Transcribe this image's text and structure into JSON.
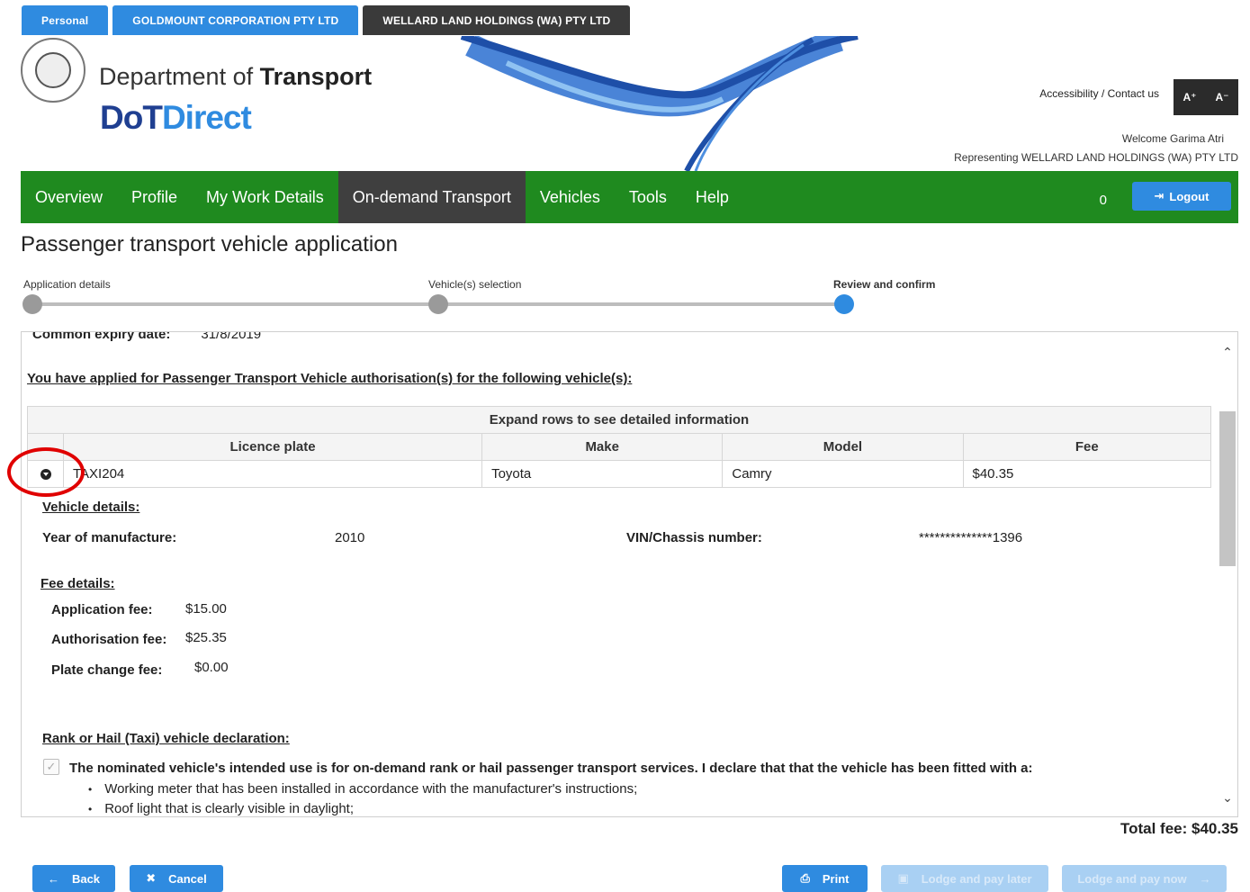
{
  "account_tabs": [
    "Personal",
    "GOLDMOUNT CORPORATION PTY LTD",
    "WELLARD LAND HOLDINGS (WA) PTY LTD"
  ],
  "header": {
    "dept_prefix": "Department of ",
    "dept_bold": "Transport",
    "brand_a": "DoT",
    "brand_b": "Direct",
    "accessibility": "Accessibility / Contact us",
    "font_up": "A⁺",
    "font_down": "A⁻",
    "welcome": "Welcome Garima Atri",
    "representing": "Representing WELLARD LAND HOLDINGS (WA) PTY LTD"
  },
  "nav": {
    "items": [
      "Overview",
      "Profile",
      "My Work Details",
      "On-demand Transport",
      "Vehicles",
      "Tools",
      "Help"
    ],
    "count": "0",
    "logout": "Logout"
  },
  "page_title": "Passenger transport vehicle application",
  "stepper": [
    "Application details",
    "Vehicle(s) selection",
    "Review and confirm"
  ],
  "panel": {
    "expiry_label": "Common expiry date:",
    "expiry_value": "31/8/2019",
    "applied_heading": "You have applied for Passenger Transport Vehicle authorisation(s) for the following vehicle(s):",
    "table_caption": "Expand rows to see detailed information",
    "columns": [
      "Licence plate",
      "Make",
      "Model",
      "Fee"
    ],
    "row": {
      "plate": "TAXI204",
      "make": "Toyota",
      "model": "Camry",
      "fee": "$40.35"
    },
    "vehicle_details_heading": "Vehicle details:",
    "year_label": "Year of manufacture:",
    "year_value": "2010",
    "vin_label": "VIN/Chassis number:",
    "vin_value": "**************1396",
    "fee_details_heading": "Fee details:",
    "app_fee_label": "Application fee:",
    "app_fee_value": "$15.00",
    "auth_fee_label": "Authorisation fee:",
    "auth_fee_value": "$25.35",
    "plate_fee_label": "Plate change fee:",
    "plate_fee_value": "$0.00",
    "declaration_heading": "Rank or Hail (Taxi) vehicle declaration:",
    "declaration_text": "The nominated vehicle's intended use is for on-demand rank or hail passenger transport services. I declare that that the vehicle has been fitted with a:",
    "bullets": [
      "Working meter that has been installed in accordance with the manufacturer's instructions;",
      "Roof light that is clearly visible in daylight;"
    ]
  },
  "total_fee": "Total fee: $40.35",
  "buttons": {
    "back": "Back",
    "cancel": "Cancel",
    "print": "Print",
    "lodge_later": "Lodge and pay later",
    "lodge_now": "Lodge and pay now"
  }
}
